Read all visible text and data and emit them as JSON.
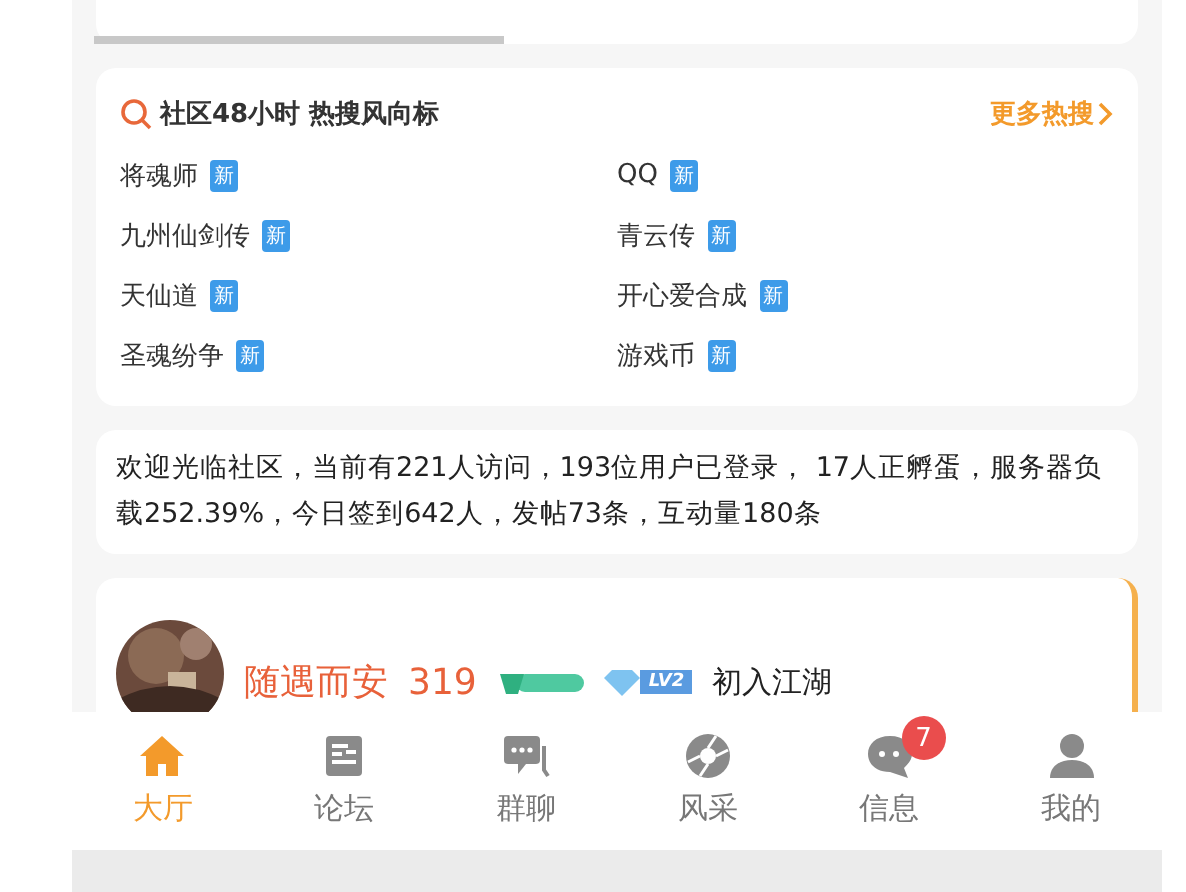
{
  "hot_search": {
    "title": "社区48小时 热搜风向标",
    "more": "更多热搜",
    "items": [
      {
        "label": "将魂师",
        "badge": "新"
      },
      {
        "label": "QQ",
        "badge": "新"
      },
      {
        "label": "九州仙剑传",
        "badge": "新"
      },
      {
        "label": "青云传",
        "badge": "新"
      },
      {
        "label": "天仙道",
        "badge": "新"
      },
      {
        "label": "开心爱合成",
        "badge": "新"
      },
      {
        "label": "圣魂纷争",
        "badge": "新"
      },
      {
        "label": "游戏币",
        "badge": "新"
      }
    ]
  },
  "stats": "欢迎光临社区，当前有221人访问，193位用户已登录， 17人正孵蛋，服务器负载252.39%，今日签到642人，发帖73条，互动量180条",
  "user": {
    "name": "随遇而安",
    "score": "319",
    "vip": "LV2",
    "rank": "初入江湖"
  },
  "tabs": [
    {
      "label": "大厅",
      "selected": true
    },
    {
      "label": "论坛",
      "selected": false
    },
    {
      "label": "群聊",
      "selected": false
    },
    {
      "label": "风采",
      "selected": false
    },
    {
      "label": "信息",
      "selected": false,
      "badge": "7"
    },
    {
      "label": "我的",
      "selected": false
    }
  ]
}
